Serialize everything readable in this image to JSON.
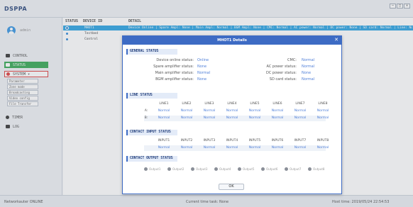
{
  "app": {
    "logo": "DSPPA"
  },
  "window_buttons": [
    "—",
    "□",
    "✕"
  ],
  "sidebar": {
    "user_name": "admin",
    "items": [
      {
        "label": "CONTROL"
      },
      {
        "label": "STATUS"
      },
      {
        "label": "SYSTEM ▾"
      }
    ],
    "system_sub": [
      "Parameter",
      "Zone mode",
      "Broadcasting",
      "Video config",
      "File Transfer"
    ],
    "bottom_items": [
      {
        "label": "TIMER"
      },
      {
        "label": "LOG"
      }
    ]
  },
  "list": {
    "headers": {
      "status": "STATUS",
      "id": "DEVICE ID",
      "detail": "DETAIL"
    },
    "rows": [
      {
        "id": "MHOT1",
        "detail": "Device Online | Spare Ampl: None | Main Ampl: Normal | BGM Ampl: None | CMC: Normal | AC power: Normal | DC power: None | SD card: Normal | Line: Normal | Input: Normal | Output: Normal",
        "selected": true
      },
      {
        "id": "Testbed",
        "detail": "",
        "selected": false
      },
      {
        "id": "Control",
        "detail": "",
        "selected": false
      }
    ]
  },
  "statusbar": {
    "left": "Networkauter ONLINE",
    "center": "Current time task: None",
    "right": "Host time: 2019/05/24 22:54:53"
  },
  "dialog": {
    "title": "MHOT1 Details",
    "close": "✕",
    "ok_label": "OK",
    "general": {
      "title": "GENERAL STATUS",
      "left": [
        {
          "label": "Device online status:",
          "value": "Online"
        },
        {
          "label": "Spare amplifier status:",
          "value": "None"
        },
        {
          "label": "Main amplifier status:",
          "value": "Normal"
        },
        {
          "label": "BGM amplifier status:",
          "value": "None"
        }
      ],
      "right": [
        {
          "label": "CMC:",
          "value": "Normal"
        },
        {
          "label": "AC power status:",
          "value": "Normal"
        },
        {
          "label": "DC power status:",
          "value": "None"
        },
        {
          "label": "SD card status:",
          "value": "Normal"
        }
      ]
    },
    "lines": {
      "title": "LINE STATUS",
      "columns": [
        "LINE1",
        "LINE2",
        "LINE3",
        "LINE4",
        "LINE5",
        "LINE6",
        "LINE7",
        "LINE8"
      ],
      "rows": [
        {
          "label": "A:",
          "values": [
            "Normal",
            "Normal",
            "Normal",
            "Normal",
            "Normal",
            "Normal",
            "Normal",
            "Normal"
          ]
        },
        {
          "label": "B:",
          "values": [
            "Normal",
            "Normal",
            "Normal",
            "Normal",
            "Normal",
            "Normal",
            "Normal",
            "Normal"
          ]
        }
      ]
    },
    "inputs": {
      "title": "CONTACT INPUT STATUS",
      "columns": [
        "INPUT1",
        "INPUT2",
        "INPUT3",
        "INPUT4",
        "INPUT5",
        "INPUT6",
        "INPUT7",
        "INPUT8"
      ],
      "values": [
        "Normal",
        "Normal",
        "Normal",
        "Normal",
        "Normal",
        "Normal",
        "Normal",
        "Normal"
      ]
    },
    "outputs": {
      "title": "CONTACT OUTPUT STATUS",
      "items": [
        "Output1",
        "Output2",
        "Output3",
        "Output4",
        "Output5",
        "Output6",
        "Output7",
        "Output8"
      ]
    }
  },
  "colors": {
    "accent": "#3d6bc4",
    "value_blue": "#4f7fd8",
    "active_green": "#2aa34a",
    "selected_row": "#1f9ee0"
  }
}
